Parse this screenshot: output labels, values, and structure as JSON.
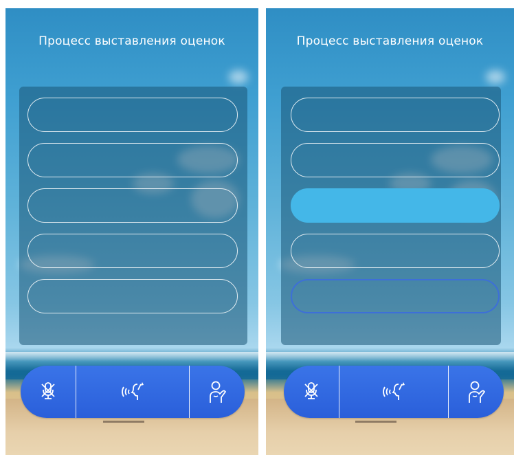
{
  "screens": [
    {
      "title": "Процесс выставления оценок",
      "rating_slots": [
        {
          "state": "empty"
        },
        {
          "state": "empty"
        },
        {
          "state": "empty"
        },
        {
          "state": "empty"
        },
        {
          "state": "empty"
        }
      ],
      "toolbar": {
        "left_icon": "mic-muted-icon",
        "center_icon": "voice-speak-icon",
        "right_icon": "raise-hand-icon"
      }
    },
    {
      "title": "Процесс выставления оценок",
      "rating_slots": [
        {
          "state": "empty"
        },
        {
          "state": "empty"
        },
        {
          "state": "selected"
        },
        {
          "state": "empty"
        },
        {
          "state": "focused"
        }
      ],
      "toolbar": {
        "left_icon": "mic-muted-icon",
        "center_icon": "voice-speak-icon",
        "right_icon": "raise-hand-icon"
      }
    }
  ],
  "colors": {
    "selected_fill": "#44b7e8",
    "focus_outline": "#3d6fd8",
    "toolbar": "#2f66dd"
  }
}
